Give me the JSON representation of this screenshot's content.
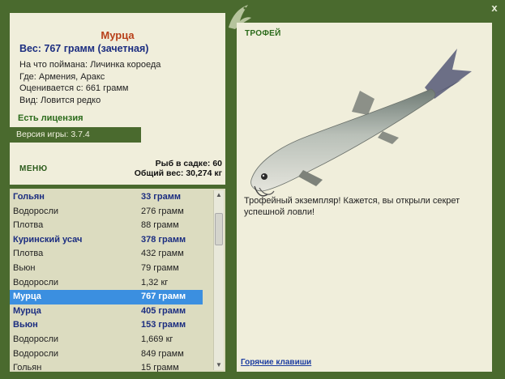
{
  "window": {
    "close_glyph": "x"
  },
  "fish": {
    "name": "Мурца",
    "weight_line": "Вес: 767 грамм (зачетная)",
    "bait": "На что поймана: Личинка короеда",
    "place": "Где: Армения, Аракс",
    "value": "Оценивается с: 661 грамм",
    "kind": "Вид: Ловится редко"
  },
  "license": "Есть лицензия",
  "version": "Версия игры: 3.7.4",
  "menu_label": "МЕНЮ",
  "cage": {
    "count": "Рыб в садке: 60",
    "total": "Общий вес: 30,274 кг"
  },
  "catch_list": [
    {
      "name": "Гольян",
      "weight": "33 грамм",
      "style": "bold"
    },
    {
      "name": "Водоросли",
      "weight": "276 грамм",
      "style": "normal"
    },
    {
      "name": "Плотва",
      "weight": "88 грамм",
      "style": "normal"
    },
    {
      "name": "Куринский усач",
      "weight": "378 грамм",
      "style": "bold"
    },
    {
      "name": "Плотва",
      "weight": "432 грамм",
      "style": "normal"
    },
    {
      "name": "Вьюн",
      "weight": "79 грамм",
      "style": "normal"
    },
    {
      "name": "Водоросли",
      "weight": "1,32 кг",
      "style": "normal"
    },
    {
      "name": "Мурца",
      "weight": "767 грамм",
      "style": "selected"
    },
    {
      "name": "Мурца",
      "weight": "405 грамм",
      "style": "bold"
    },
    {
      "name": "Вьюн",
      "weight": "153 грамм",
      "style": "bold"
    },
    {
      "name": "Водоросли",
      "weight": "1,669 кг",
      "style": "normal"
    },
    {
      "name": "Водоросли",
      "weight": "849 грамм",
      "style": "normal"
    },
    {
      "name": "Гольян",
      "weight": "15 грамм",
      "style": "normal"
    }
  ],
  "trophy": {
    "title": "ТРОФЕЙ",
    "text": "Трофейный экземпляр! Кажется, вы открыли секрет успешной ловли!"
  },
  "hotkeys_label": "Горячие клавиши",
  "colors": {
    "frame": "#4a6a2e",
    "panel": "#f0eedb",
    "list_bg": "#dcdcc0",
    "selected": "#3b8fe0",
    "name_title": "#b8401a",
    "bold_blue": "#1b2d80"
  }
}
